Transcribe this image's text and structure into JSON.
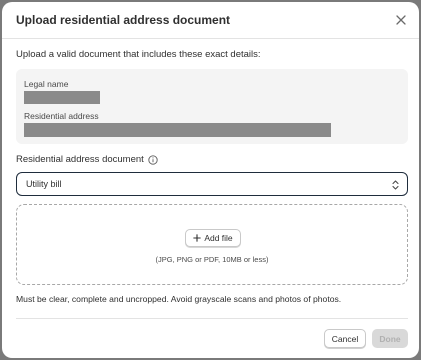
{
  "modal": {
    "title": "Upload residential address document",
    "intro": "Upload a valid document that includes these exact details:"
  },
  "details": {
    "legal_name_label": "Legal name",
    "residential_address_label": "Residential address"
  },
  "document_field": {
    "label": "Residential address document",
    "selected": "Utility bill"
  },
  "dropzone": {
    "add_file_label": "Add file",
    "hint": "(JPG, PNG or PDF, 10MB or less)"
  },
  "footnote": "Must be clear, complete and uncropped. Avoid grayscale scans and photos of photos.",
  "footer": {
    "cancel_label": "Cancel",
    "done_label": "Done"
  },
  "colors": {
    "select_border": "#1f2d3d",
    "done_disabled_bg": "#d9d9d9"
  }
}
